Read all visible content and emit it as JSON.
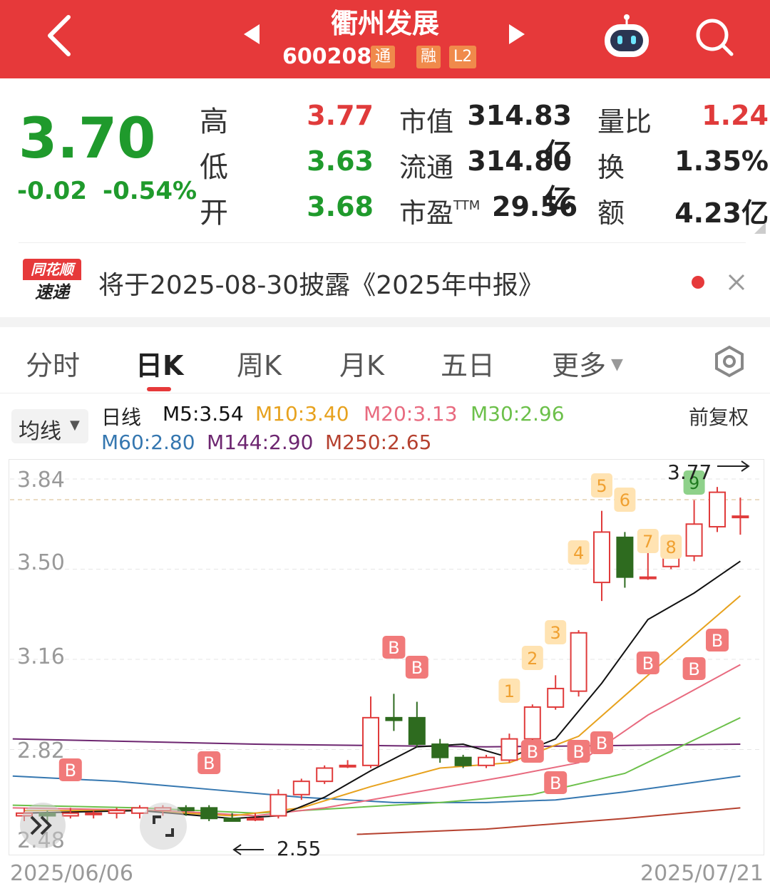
{
  "header": {
    "title": "衢州发展",
    "code": "600208",
    "tag_tong": "通",
    "tag_rong": "融",
    "tag_l2": "L2"
  },
  "quote": {
    "price": "3.70",
    "change": "-0.02",
    "change_pct": "-0.54%",
    "high_label": "高",
    "high": "3.77",
    "low_label": "低",
    "low": "3.63",
    "open_label": "开",
    "open": "3.68",
    "mcap_label": "市值",
    "mcap": "314.83亿",
    "float_label": "流通",
    "float": "314.80亿",
    "pe_label": "市盈",
    "pe_sup": "TTM",
    "pe": "29.56",
    "vr_label": "量比",
    "vr": "1.24",
    "turn_label": "换",
    "turn": "1.35%",
    "amt_label": "额",
    "amt": "4.23亿"
  },
  "news": {
    "logo_top": "同花顺",
    "logo_bottom": "速递",
    "text": "将于2025-08-30披露《2025年中报》"
  },
  "tabs": [
    "分时",
    "日K",
    "周K",
    "月K",
    "五日",
    "更多"
  ],
  "legend": {
    "selector": "均线",
    "period": "日线",
    "m5": "M5:3.54",
    "m10": "M10:3.40",
    "m20": "M20:3.13",
    "m30": "M30:2.96",
    "m60": "M60:2.80",
    "m144": "M144:2.90",
    "m250": "M250:2.65",
    "adjust": "前复权"
  },
  "colors": {
    "header_red": "#e6393a",
    "rise": "#e03b3b",
    "fall": "#2e6b1f",
    "m5": "#111111",
    "m10": "#e7a21e",
    "m20": "#e86a7f",
    "m30": "#6cc04a",
    "m60": "#3577b0",
    "m144": "#6d2670",
    "m250": "#b5412f"
  },
  "chart_data": {
    "type": "candlestick",
    "y_ticks": [
      "3.84",
      "3.50",
      "3.16",
      "2.82",
      "2.48"
    ],
    "x_start": "2025/06/06",
    "x_end": "2025/07/21",
    "max_label": "3.77",
    "min_label": "2.55",
    "candles": [
      {
        "o": 2.57,
        "c": 2.58,
        "h": 2.6,
        "l": 2.55
      },
      {
        "o": 2.58,
        "c": 2.57,
        "h": 2.59,
        "l": 2.55
      },
      {
        "o": 2.57,
        "c": 2.58,
        "h": 2.6,
        "l": 2.56
      },
      {
        "o": 2.58,
        "c": 2.58,
        "h": 2.59,
        "l": 2.56
      },
      {
        "o": 2.58,
        "c": 2.59,
        "h": 2.6,
        "l": 2.56
      },
      {
        "o": 2.58,
        "c": 2.6,
        "h": 2.61,
        "l": 2.56
      },
      {
        "o": 2.59,
        "c": 2.6,
        "h": 2.61,
        "l": 2.57
      },
      {
        "o": 2.6,
        "c": 2.59,
        "h": 2.61,
        "l": 2.57
      },
      {
        "o": 2.6,
        "c": 2.56,
        "h": 2.61,
        "l": 2.55
      },
      {
        "o": 2.56,
        "c": 2.55,
        "h": 2.58,
        "l": 2.55
      },
      {
        "o": 2.56,
        "c": 2.56,
        "h": 2.58,
        "l": 2.55
      },
      {
        "o": 2.57,
        "c": 2.65,
        "h": 2.67,
        "l": 2.56
      },
      {
        "o": 2.65,
        "c": 2.7,
        "h": 2.71,
        "l": 2.63
      },
      {
        "o": 2.7,
        "c": 2.75,
        "h": 2.76,
        "l": 2.69
      },
      {
        "o": 2.76,
        "c": 2.76,
        "h": 2.78,
        "l": 2.75
      },
      {
        "o": 2.76,
        "c": 2.94,
        "h": 3.02,
        "l": 2.75
      },
      {
        "o": 2.94,
        "c": 2.93,
        "h": 3.03,
        "l": 2.89
      },
      {
        "o": 2.94,
        "c": 2.84,
        "h": 3.0,
        "l": 2.83
      },
      {
        "o": 2.84,
        "c": 2.79,
        "h": 2.86,
        "l": 2.77
      },
      {
        "o": 2.79,
        "c": 2.76,
        "h": 2.8,
        "l": 2.75
      },
      {
        "o": 2.76,
        "c": 2.79,
        "h": 2.8,
        "l": 2.75
      },
      {
        "o": 2.78,
        "c": 2.86,
        "h": 2.88,
        "l": 2.77
      },
      {
        "o": 2.86,
        "c": 2.98,
        "h": 2.99,
        "l": 2.83
      },
      {
        "o": 2.98,
        "c": 3.05,
        "h": 3.1,
        "l": 2.97
      },
      {
        "o": 3.04,
        "c": 3.26,
        "h": 3.27,
        "l": 3.02
      },
      {
        "o": 3.45,
        "c": 3.64,
        "h": 3.72,
        "l": 3.38
      },
      {
        "o": 3.62,
        "c": 3.47,
        "h": 3.64,
        "l": 3.43
      },
      {
        "o": 3.47,
        "c": 3.47,
        "h": 3.57,
        "l": 3.46
      },
      {
        "o": 3.51,
        "c": 3.56,
        "h": 3.58,
        "l": 3.5
      },
      {
        "o": 3.55,
        "c": 3.67,
        "h": 3.76,
        "l": 3.53
      },
      {
        "o": 3.66,
        "c": 3.79,
        "h": 3.81,
        "l": 3.64
      },
      {
        "o": 3.7,
        "c": 3.7,
        "h": 3.77,
        "l": 3.63
      }
    ],
    "ma_values": {
      "M5": "3.54",
      "M10": "3.40",
      "M20": "3.13",
      "M30": "2.96",
      "M60": "2.80",
      "M144": "2.90",
      "M250": "2.65"
    },
    "buy_marks": [
      "B",
      "B",
      "B",
      "B",
      "B",
      "B",
      "B",
      "B",
      "B",
      "B",
      "B"
    ],
    "step_marks": [
      "1",
      "2",
      "3",
      "4",
      "5",
      "6",
      "7",
      "8",
      "9"
    ]
  }
}
